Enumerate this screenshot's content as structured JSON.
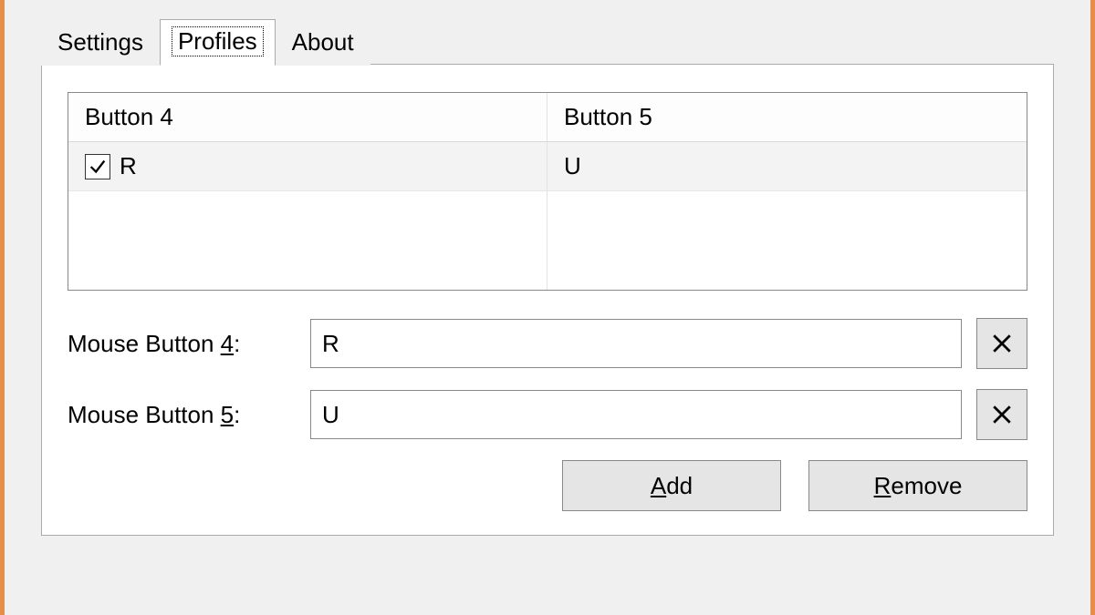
{
  "tabs": {
    "settings": "Settings",
    "profiles": "Profiles",
    "about": "About",
    "active": "profiles"
  },
  "grid": {
    "headers": {
      "c0": "Button 4",
      "c1": "Button 5"
    },
    "rows": [
      {
        "checked": true,
        "c0": "R",
        "c1": "U"
      }
    ]
  },
  "fields": {
    "mb4": {
      "label_pre": "Mouse Button ",
      "label_key": "4",
      "label_post": ":",
      "value": "R"
    },
    "mb5": {
      "label_pre": "Mouse Button ",
      "label_key": "5",
      "label_post": ":",
      "value": "U"
    }
  },
  "buttons": {
    "add": {
      "key": "A",
      "rest": "dd"
    },
    "remove": {
      "key": "R",
      "rest": "emove"
    }
  }
}
